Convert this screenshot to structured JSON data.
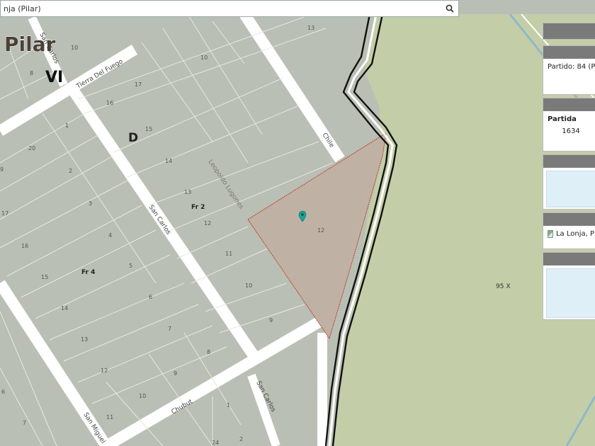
{
  "search": {
    "value": "nja (Pilar)"
  },
  "map_labels": {
    "locality": "Pilar",
    "section": "VI",
    "block": "D",
    "fraction_2": "Fr 2",
    "fraction_4": "Fr 4",
    "parcel_95x": "95 X",
    "parcel_12": "12"
  },
  "streets": {
    "tierra_del_fuego": "Tierra Del Fuego",
    "san_carlos": "San Carlos",
    "san_carlos_lower": "San Carlos",
    "chile": "Chile",
    "chubut": "Chubut",
    "leopoldo_lugones": "Leopoldo Lugones",
    "san_carlos_top": "San Carlos",
    "san_miguel": "San Miguel"
  },
  "lots": {
    "left_column": [
      "8",
      "1",
      "20",
      "9",
      "17",
      "16",
      "15",
      "14",
      "13",
      "12",
      "6",
      "7"
    ],
    "middle_column": [
      "10",
      "2",
      "3",
      "4",
      "5",
      "6",
      "7",
      "8",
      "9",
      "10",
      "11"
    ],
    "block_d": [
      "10",
      "17",
      "16",
      "15",
      "14",
      "13",
      "12",
      "11",
      "10",
      "9"
    ],
    "top": "13",
    "bottom": [
      "1",
      "2",
      "24"
    ]
  },
  "panels": {
    "partido": "Partido: 84 (Pila",
    "partida_header": "Partida",
    "partida_value": "1634",
    "location_link": "La Lonja, P"
  },
  "colors": {
    "map_background": "#b9bfb4",
    "green_area": "#c3cea8",
    "selected_parcel": "#bfb2a4",
    "selected_outline": "#c0392b",
    "marker": "#1aa39a"
  }
}
